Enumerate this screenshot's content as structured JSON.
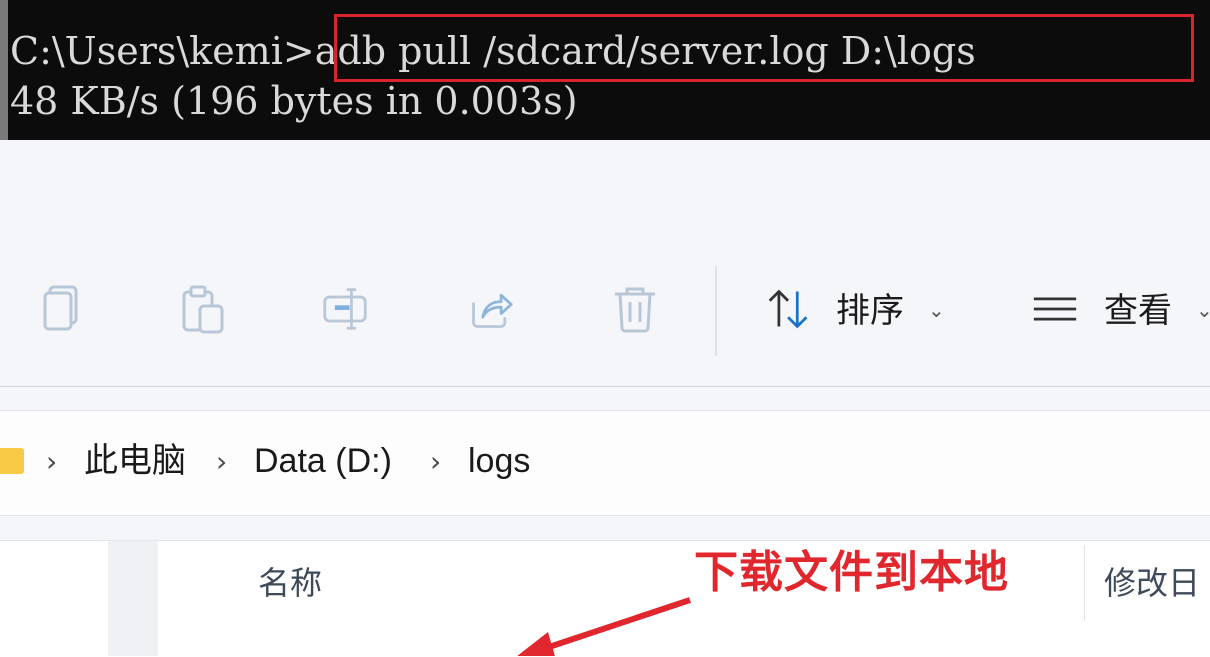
{
  "terminal": {
    "prompt": "C:\\Users\\kemi>",
    "command": "adb pull /sdcard/server.log D:\\logs",
    "output": "48 KB/s (196 bytes in 0.003s)",
    "highlight_color": "#d9242b"
  },
  "toolbar": {
    "icons": [
      "copy-icon",
      "paste-icon",
      "rename-icon",
      "share-icon",
      "delete-icon"
    ],
    "sort_label": "排序",
    "view_label": "查看"
  },
  "breadcrumb": {
    "items": [
      "此电脑",
      "Data (D:)",
      "logs"
    ],
    "separator": ">"
  },
  "file_list": {
    "columns": [
      "名称",
      "修改日"
    ]
  },
  "annotation": {
    "text": "下载文件到本地",
    "color": "#e0272e"
  }
}
